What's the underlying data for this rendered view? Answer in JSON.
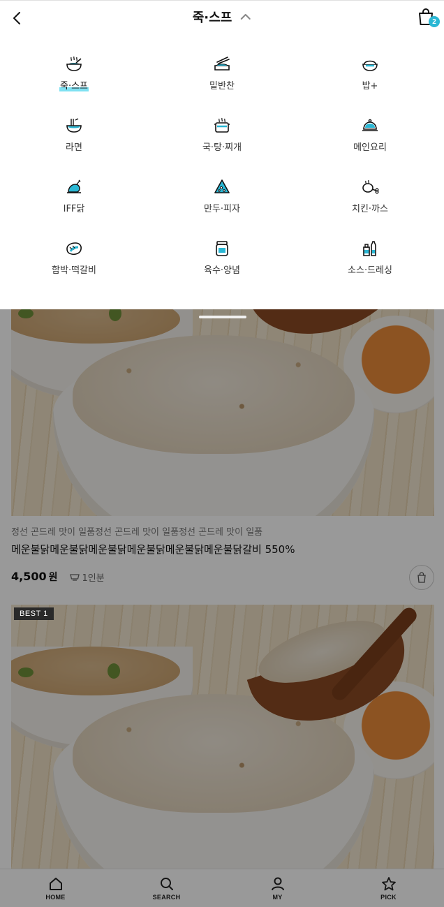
{
  "header": {
    "title": "죽·스프",
    "cart_count": "2"
  },
  "categories": [
    {
      "label": "죽·스프",
      "icon": "porridge-bowl-icon",
      "active": true
    },
    {
      "label": "밑반찬",
      "icon": "side-dish-icon",
      "active": false
    },
    {
      "label": "밥+",
      "icon": "rice-bowl-icon",
      "active": false
    },
    {
      "label": "라면",
      "icon": "noodle-bowl-icon",
      "active": false
    },
    {
      "label": "국·탕·찌개",
      "icon": "soup-pot-icon",
      "active": false
    },
    {
      "label": "메인요리",
      "icon": "cloche-icon",
      "active": false
    },
    {
      "label": "IFF닭",
      "icon": "chicken-icon",
      "active": false
    },
    {
      "label": "만두·피자",
      "icon": "pizza-slice-icon",
      "active": false
    },
    {
      "label": "치킨·까스",
      "icon": "drumstick-icon",
      "active": false
    },
    {
      "label": "함박·떡갈비",
      "icon": "steak-icon",
      "active": false
    },
    {
      "label": "육수·양념",
      "icon": "jar-icon",
      "active": false
    },
    {
      "label": "소스·드레싱",
      "icon": "sauce-bottles-icon",
      "active": false
    }
  ],
  "products": [
    {
      "badge": "",
      "subtitle": "정선 곤드레 맛이 일품정선 곤드레 맛이 일품정선 곤드레 맛이 일품",
      "title": "메운불닭메운불닭메운불닭메운불닭메운불닭메운불닭갈비 550%",
      "price": "4,500",
      "price_unit": "원",
      "serving": "1인분"
    },
    {
      "badge": "BEST  1",
      "subtitle": "",
      "title": "",
      "price": "",
      "price_unit": "",
      "serving": ""
    }
  ],
  "bottom_nav": [
    {
      "label": "HOME",
      "icon": "home-icon"
    },
    {
      "label": "SEARCH",
      "icon": "search-icon"
    },
    {
      "label": "MY",
      "icon": "person-icon"
    },
    {
      "label": "PICK",
      "icon": "star-icon"
    }
  ],
  "colors": {
    "accent": "#2ab7d4",
    "highlight": "#7fe1f2",
    "overlay": "rgba(0,0,0,0.4)"
  }
}
